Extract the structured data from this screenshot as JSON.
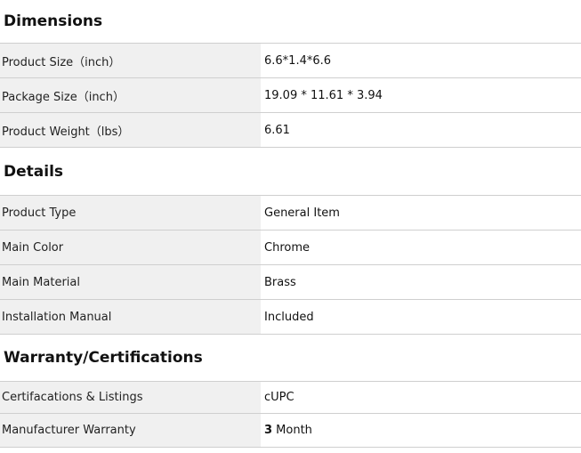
{
  "sections": {
    "dimensions": {
      "title": "Dimensions",
      "rows": [
        {
          "label": "Product Size（inch）",
          "value": "6.6*1.4*6.6"
        },
        {
          "label": "Package Size（inch）",
          "value": "19.09 * 11.61 * 3.94"
        },
        {
          "label": "Product Weight（lbs）",
          "value": "6.61"
        }
      ]
    },
    "details": {
      "title": "Details",
      "rows": [
        {
          "label": "Product Type",
          "value": "General Item"
        },
        {
          "label": "Main Color",
          "value": "Chrome"
        },
        {
          "label": "Main Material",
          "value": "Brass"
        },
        {
          "label": "Installation Manual",
          "value": "Included"
        }
      ]
    },
    "warranty": {
      "title": "Warranty/Certifications",
      "rows": [
        {
          "label": "Certifacations & Listings",
          "value": "cUPC"
        },
        {
          "label": "Manufacturer Warranty",
          "value_number": "3",
          "value_unit": " Month"
        }
      ]
    }
  }
}
